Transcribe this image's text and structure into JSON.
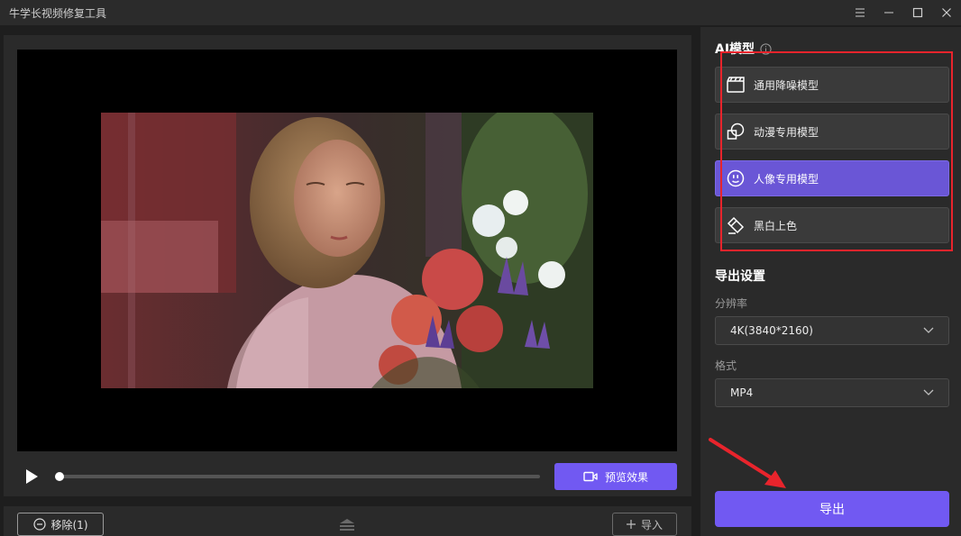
{
  "window": {
    "title": "牛学长视频修复工具",
    "controls": [
      "menu-icon",
      "minimize-icon",
      "maximize-icon",
      "close-icon"
    ]
  },
  "player": {
    "progress": 0.0,
    "preview_label": "预览效果"
  },
  "file_bar": {
    "remove_label": "移除(1)",
    "import_label": "导入"
  },
  "ai_model": {
    "title": "AI模型",
    "models": [
      {
        "label": "通用降噪模型",
        "icon": "clapperboard-icon",
        "selected": false
      },
      {
        "label": "动漫专用模型",
        "icon": "shapes-icon",
        "selected": false
      },
      {
        "label": "人像专用模型",
        "icon": "face-icon",
        "selected": true
      },
      {
        "label": "黑白上色",
        "icon": "eraser-icon",
        "selected": false
      }
    ]
  },
  "export_settings": {
    "title": "导出设置",
    "resolution_label": "分辨率",
    "resolution_value": "4K(3840*2160)",
    "format_label": "格式",
    "format_value": "MP4",
    "export_label": "导出"
  },
  "colors": {
    "accent": "#7159f2",
    "selected_model": "#6a56d6",
    "annotation": "#e8242c"
  }
}
